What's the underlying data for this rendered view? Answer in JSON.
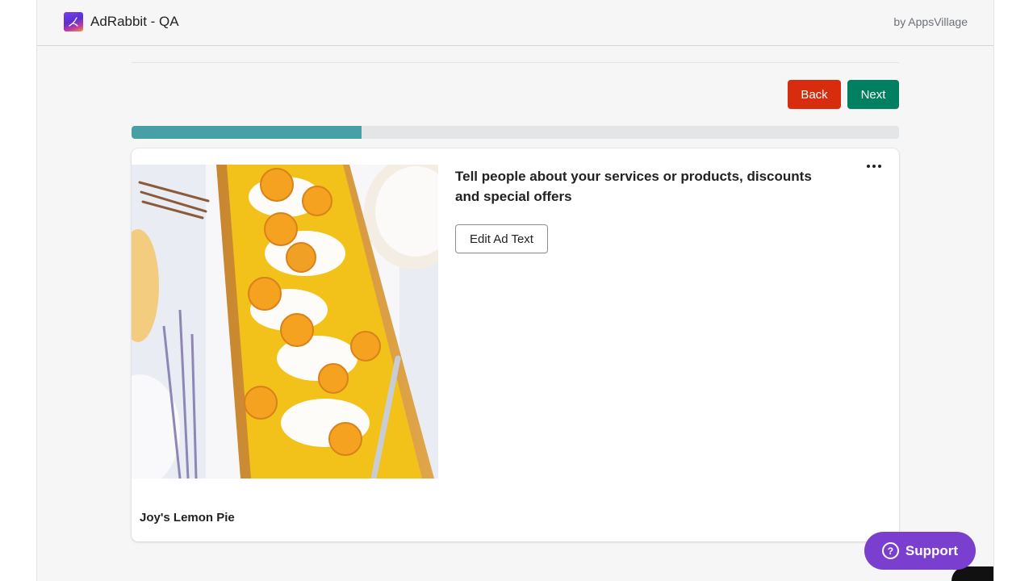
{
  "header": {
    "app_title": "AdRabbit - QA",
    "vendor": "by AppsVillage",
    "logo_icon": "rabbit-logo-icon"
  },
  "actions": {
    "back_label": "Back",
    "next_label": "Next"
  },
  "progress": {
    "fraction": 0.3
  },
  "ad_card": {
    "headline": "Tell people about your services or products, discounts and special offers",
    "edit_button": "Edit Ad Text",
    "more_icon": "more-horizontal-icon",
    "image_icon": "lemon-pie-photo",
    "caption": "Joy's Lemon Pie"
  },
  "support": {
    "label": "Support",
    "icon": "question-circle-icon"
  },
  "colors": {
    "back": "#d72c0d",
    "next": "#008060",
    "progress_fill": "#47a0a6",
    "support": "#7b3fd0"
  }
}
